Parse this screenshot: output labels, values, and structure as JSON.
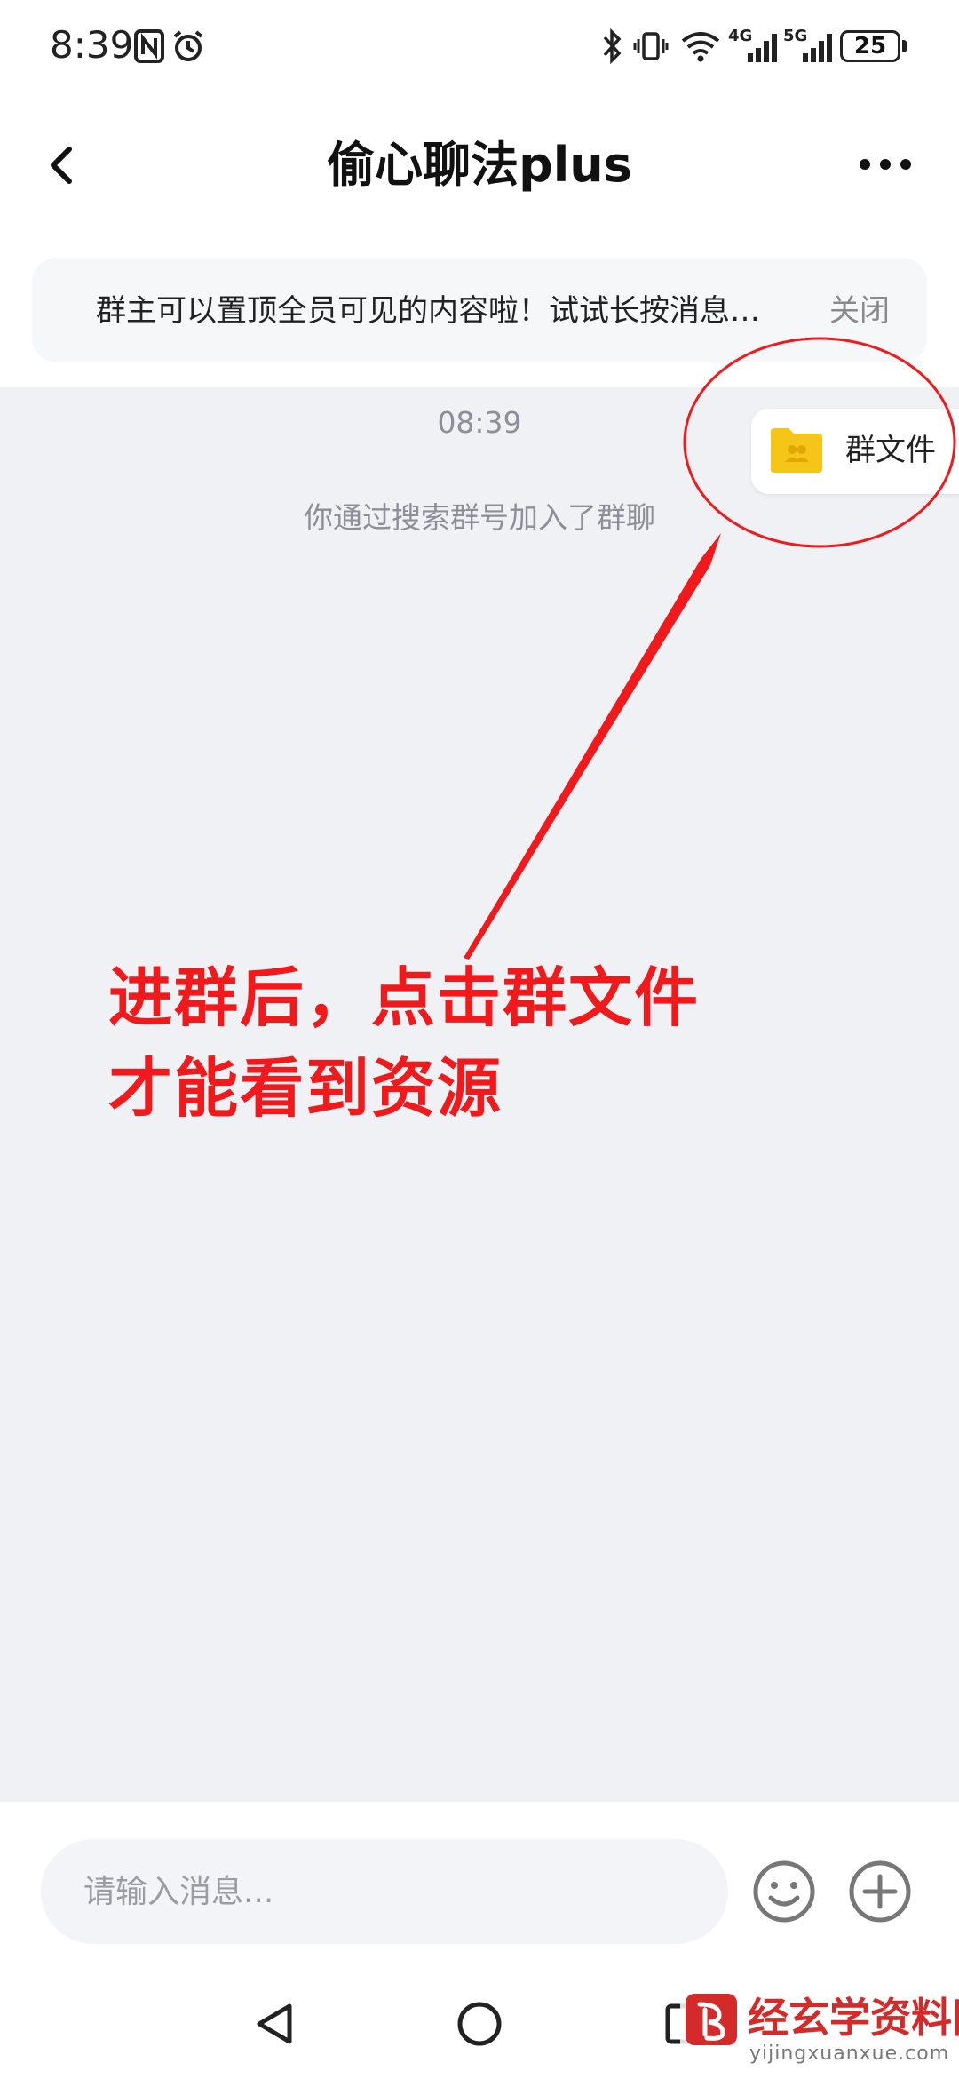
{
  "status_bar": {
    "time": "8:39",
    "network_4g": "4G",
    "network_5g": "5G",
    "battery": "25"
  },
  "header": {
    "title": "偷心聊法plus",
    "back_icon": "chevron-left-icon",
    "more_icon": "more-dots-icon"
  },
  "tip_banner": {
    "text": "群主可以置顶全员可见的内容啦！试试长按消息…",
    "close_label": "关闭"
  },
  "chat": {
    "time": "08:39",
    "system_message": "你通过搜索群号加入了群聊",
    "group_file": {
      "label": "群文件",
      "icon": "folder-icon",
      "icon_color": "#f5c518"
    }
  },
  "annotation": {
    "line1": "进群后，点击群文件",
    "line2": "才能看到资源",
    "color": "#f0191c"
  },
  "input_bar": {
    "placeholder": "请输入消息...",
    "emoji_icon": "smiley-icon",
    "plus_icon": "plus-circle-icon"
  },
  "nav_bar": {
    "back_icon": "triangle-back-icon",
    "home_icon": "circle-home-icon",
    "recent_icon": "square-recent-icon"
  },
  "watermark": {
    "title": "经玄学资料网",
    "subtitle": "yijingxuanxue.com"
  }
}
